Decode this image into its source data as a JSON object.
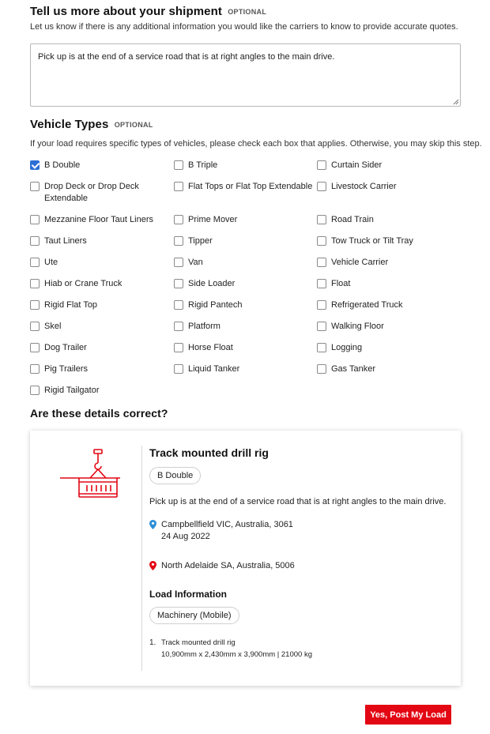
{
  "shipment_info": {
    "heading": "Tell us more about your shipment",
    "optional_tag": "OPTIONAL",
    "subtitle": "Let us know if there is any additional information you would like the carriers to know to provide accurate quotes.",
    "textarea_value": "Pick up is at the end of a service road that is at right angles to the main drive."
  },
  "vehicle_types": {
    "heading": "Vehicle Types",
    "optional_tag": "OPTIONAL",
    "subtitle": "If your load requires specific types of vehicles, please check each box that applies. Otherwise, you may skip this step.",
    "options": [
      {
        "label": "B Double",
        "checked": true
      },
      {
        "label": "B Triple",
        "checked": false
      },
      {
        "label": "Curtain Sider",
        "checked": false
      },
      {
        "label": "Drop Deck or Drop Deck Extendable",
        "checked": false
      },
      {
        "label": "Flat Tops or Flat Top Extendable",
        "checked": false
      },
      {
        "label": "Livestock Carrier",
        "checked": false
      },
      {
        "label": "Mezzanine Floor Taut Liners",
        "checked": false
      },
      {
        "label": "Prime Mover",
        "checked": false
      },
      {
        "label": "Road Train",
        "checked": false
      },
      {
        "label": "Taut Liners",
        "checked": false
      },
      {
        "label": "Tipper",
        "checked": false
      },
      {
        "label": "Tow Truck or Tilt Tray",
        "checked": false
      },
      {
        "label": "Ute",
        "checked": false
      },
      {
        "label": "Van",
        "checked": false
      },
      {
        "label": "Vehicle Carrier",
        "checked": false
      },
      {
        "label": "Hiab or Crane Truck",
        "checked": false
      },
      {
        "label": "Side Loader",
        "checked": false
      },
      {
        "label": "Float",
        "checked": false
      },
      {
        "label": "Rigid Flat Top",
        "checked": false
      },
      {
        "label": "Rigid Pantech",
        "checked": false
      },
      {
        "label": "Refrigerated Truck",
        "checked": false
      },
      {
        "label": "Skel",
        "checked": false
      },
      {
        "label": "Platform",
        "checked": false
      },
      {
        "label": "Walking Floor",
        "checked": false
      },
      {
        "label": "Dog Trailer",
        "checked": false
      },
      {
        "label": "Horse Float",
        "checked": false
      },
      {
        "label": "Logging",
        "checked": false
      },
      {
        "label": "Pig Trailers",
        "checked": false
      },
      {
        "label": "Liquid Tanker",
        "checked": false
      },
      {
        "label": "Gas Tanker",
        "checked": false
      },
      {
        "label": "Rigid Tailgator",
        "checked": false
      }
    ]
  },
  "confirm": {
    "heading": "Are these details correct?",
    "card": {
      "icon": "crane-container-icon",
      "title": "Track mounted drill rig",
      "vehicle_pill": "B Double",
      "description": "Pick up is at the end of a service road that is at right angles to the main drive.",
      "pickup_location": "Campbellfield VIC, Australia, 3061",
      "pickup_date": "24 Aug 2022",
      "dropoff_location": "North Adelaide SA, Australia, 5006",
      "load_info_heading": "Load Information",
      "load_category_pill": "Machinery (Mobile)",
      "items": [
        {
          "number": "1.",
          "name": "Track mounted drill rig",
          "details": "10,900mm x 2,430mm x 3,900mm | 21000 kg"
        }
      ]
    }
  },
  "actions": {
    "post_label": "Yes, Post My Load"
  },
  "colors": {
    "brand_red": "#e30613",
    "checkbox_blue": "#2b6fd6",
    "pickup_pin": "#2b8fd6",
    "dropoff_pin": "#e30613"
  }
}
